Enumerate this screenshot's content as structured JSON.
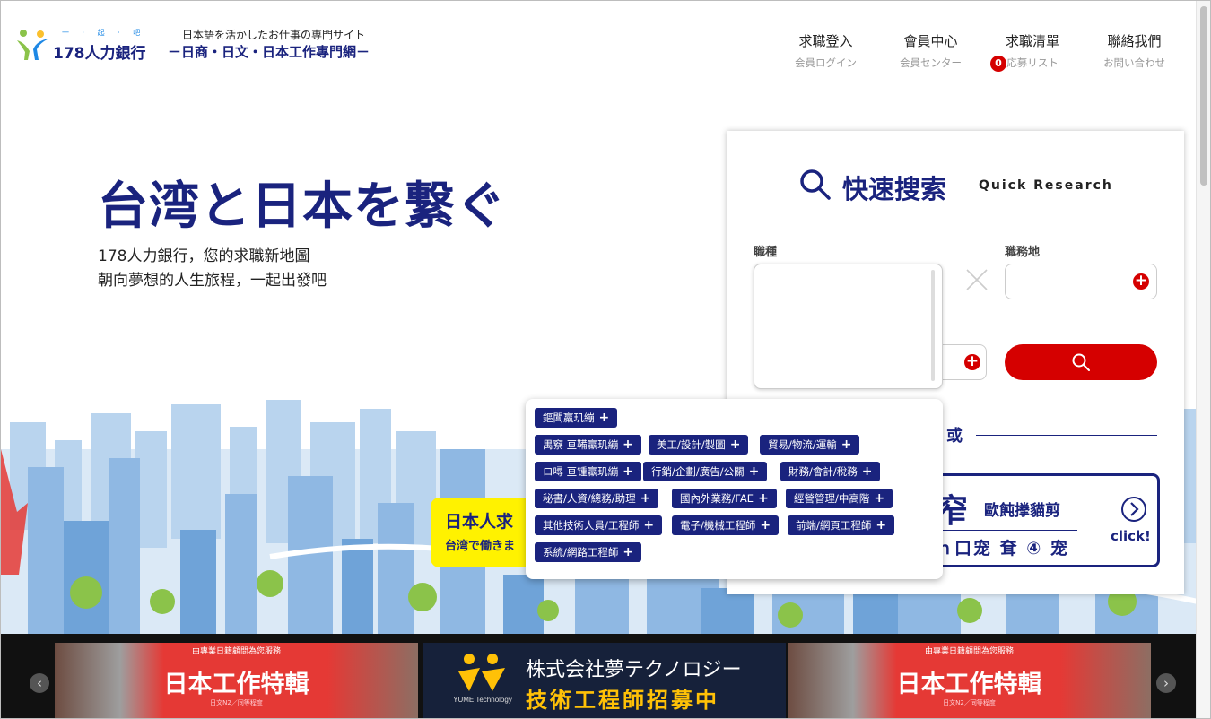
{
  "header": {
    "logo_text": "178人力銀行",
    "logo_dots": "一 · 起 · 吧",
    "tagline_top": "日本語を活かしたお仕事の専門サイト",
    "tagline_main": "－日商・日文・日本工作專門網－",
    "nav": [
      {
        "label": "求職登入",
        "sub": "会員ログイン"
      },
      {
        "label": "會員中心",
        "sub": "会員センター"
      },
      {
        "label": "求職清單",
        "sub": "応募リスト",
        "badge": "0"
      },
      {
        "label": "聯絡我們",
        "sub": "お問い合わせ"
      }
    ]
  },
  "hero": {
    "title": "台湾と日本を繋ぐ",
    "subtitle_line1": "178人力銀行，您的求職新地圖",
    "subtitle_line2": "朝向夢想的人生旅程，一起出發吧",
    "yellow_line1": "日本人求",
    "yellow_line2": "台湾で働きま"
  },
  "quick_search": {
    "title": "快速搜索",
    "title_en": "Quick Research",
    "job_label": "職種",
    "location_label": "職務地",
    "or_text": "或",
    "banner_big": "窄",
    "banner_small": "歐飩搼貓剪",
    "banner_bottom": "ｈ口宠 耷 ④ 宠",
    "banner_click": "click!"
  },
  "job_categories": [
    "鏂閶羸玑繃",
    "禺竂 亘鞴羸玑繃",
    "美工/設計/製圖",
    "貿易/物流/運輸",
    "ロ噚 亘锺羸玑繃",
    "行銷/企劃/廣告/公關",
    "財務/會計/稅務",
    "秘書/人資/總務/助理",
    "國內外業務/FAE",
    "經營管理/中高階",
    "其他技術人員/工程師",
    "電子/機械工程師",
    "前端/網頁工程師",
    "系統/網路工程師"
  ],
  "carousel": {
    "slides": [
      {
        "top": "由專業日籍顧問為您服務",
        "main": "日本工作特輯",
        "note": "日文N2／同等程度"
      },
      {
        "logo": "YUME Technology",
        "line1": "株式会社夢テクノロジー",
        "line2": "技術工程師招募中"
      },
      {
        "top": "由專業日籍顧問為您服務",
        "main": "日本工作特輯",
        "note": "日文N2／同等程度"
      }
    ]
  },
  "icons": {
    "search": "search-icon",
    "add": "plus-circle-icon",
    "clear": "close-icon",
    "next": "chevron-right-icon",
    "prev": "chevron-left-icon"
  },
  "colors": {
    "brand_navy": "#1a237e",
    "accent_red": "#d50000",
    "highlight_yellow": "#fff200"
  }
}
